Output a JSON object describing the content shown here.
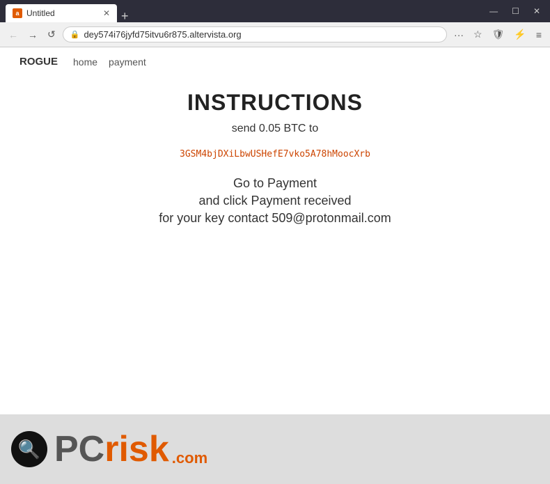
{
  "window": {
    "title": "Untitled",
    "favicon": "a"
  },
  "titlebar": {
    "new_tab_icon": "+",
    "minimize": "—",
    "restore": "☐",
    "close": "✕"
  },
  "navbar": {
    "back": "←",
    "forward": "→",
    "refresh": "↺",
    "address": "dey574i76jyfd75itvu6r875.altervista.org",
    "more_icon": "···",
    "star_icon": "☆",
    "shield_icon": "🛡",
    "extensions_icon": "⚡",
    "menu_icon": "≡"
  },
  "sitenav": {
    "brand": "ROGUE",
    "links": [
      "home",
      "payment"
    ]
  },
  "main": {
    "title": "INSTRUCTIONS",
    "send_text": "send 0.05 BTC to",
    "btc_address": "3GSM4bjDXiLbwUSHefE7vko5A78hMoocXrb",
    "goto_payment": "Go to Payment",
    "and_click": "and click Payment received",
    "contact": "for your key contact 509@protonmail.com"
  },
  "watermark": {
    "pc": "PC",
    "risk": "risk",
    "dot_com": ".com"
  }
}
